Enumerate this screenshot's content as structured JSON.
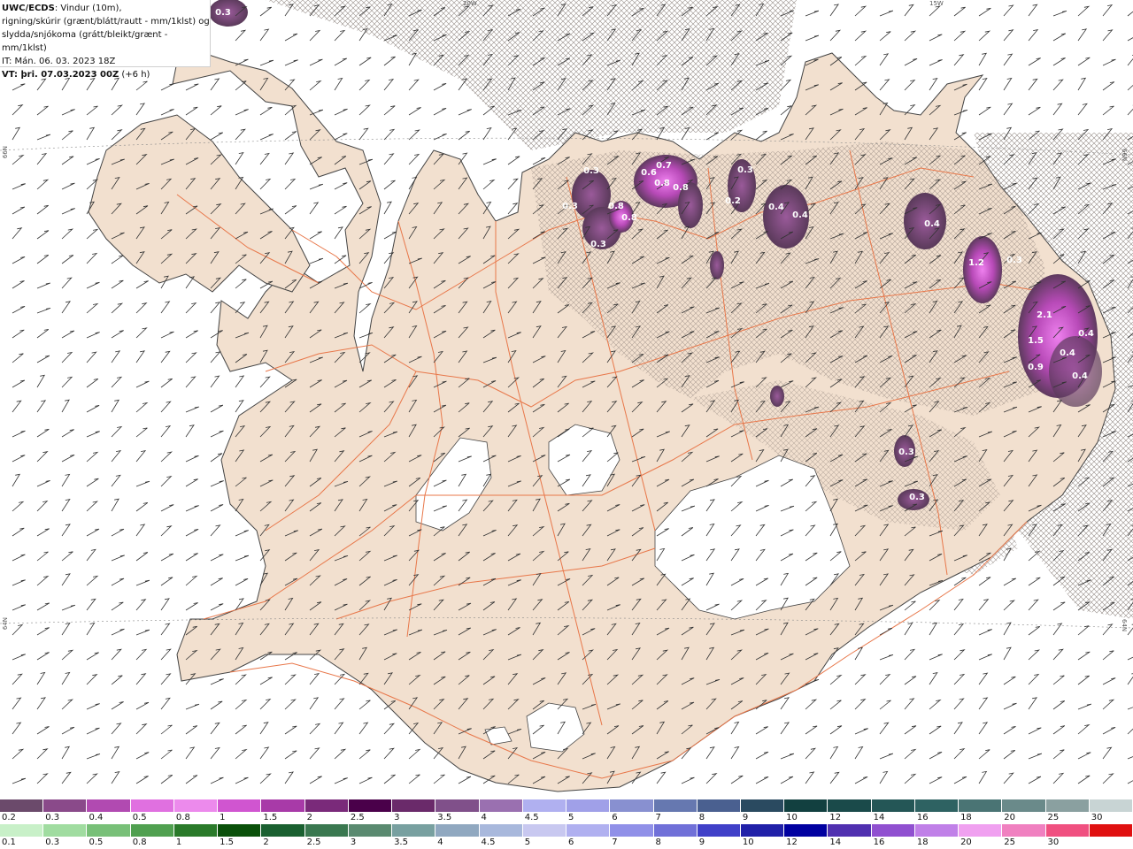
{
  "info": {
    "line1_bold": "UWC/ECDS",
    "line1_rest": ": Vindur (10m),",
    "line2": "rigning/skúrir (grænt/blátt/rautt - mm/1klst) og",
    "line3": "slydda/snjókoma (grátt/bleikt/grænt - mm/1klst)",
    "line4": "IT: Mán. 06. 03. 2023 18Z",
    "line5_bold": "VT: þri. 07.03.2023 00Z",
    "line5_rest": " (+6 h)"
  },
  "coords": {
    "top_left": "20W",
    "top_right": "15W",
    "right_upper": "66N",
    "right_lower": "64N",
    "left_upper": "66N",
    "left_lower": "64N"
  },
  "map_labels": [
    {
      "text": "0.3"
    },
    {
      "text": "0.3"
    },
    {
      "text": "0.3"
    },
    {
      "text": "0.3"
    },
    {
      "text": "0.6"
    },
    {
      "text": "0.7"
    },
    {
      "text": "0.8"
    },
    {
      "text": "0.8"
    },
    {
      "text": "0.8"
    },
    {
      "text": "0.8"
    },
    {
      "text": "0.3"
    },
    {
      "text": "0.2"
    },
    {
      "text": "0.4"
    },
    {
      "text": "0.4"
    },
    {
      "text": "0.4"
    },
    {
      "text": "1.2"
    },
    {
      "text": "0.3"
    },
    {
      "text": "2.1"
    },
    {
      "text": "1.5"
    },
    {
      "text": "0.9"
    },
    {
      "text": "0.4"
    },
    {
      "text": "0.4"
    },
    {
      "text": "0.4"
    },
    {
      "text": "0.3"
    },
    {
      "text": "0.3"
    }
  ],
  "legend_snow": {
    "labels": [
      "0.2",
      "0.3",
      "0.4",
      "0.5",
      "0.8",
      "1",
      "1.5",
      "2",
      "2.5",
      "3",
      "3.5",
      "4",
      "4.5",
      "5",
      "6",
      "7",
      "8",
      "9",
      "10",
      "12",
      "14",
      "16",
      "18",
      "20",
      "25",
      "30"
    ],
    "colors": [
      "#6b4a6b",
      "#8a4a8a",
      "#b14ab1",
      "#e070e0",
      "#ec8aec",
      "#d055d0",
      "#a83aa8",
      "#7a2a7a",
      "#4a004a",
      "#6a2a6a",
      "#80508a",
      "#9a70b0",
      "#b0b0f0",
      "#a0a0e8",
      "#8890d0",
      "#6678b0",
      "#4a6090",
      "#2a4a60",
      "#124040",
      "#1a4a4a",
      "#245656",
      "#2e6262",
      "#4a7474",
      "#6a8a8a",
      "#8aa0a0",
      "#c8d4d4"
    ]
  },
  "legend_rain": {
    "labels": [
      "0.1",
      "0.3",
      "0.5",
      "0.8",
      "1",
      "1.5",
      "2",
      "2.5",
      "3",
      "3.5",
      "4",
      "4.5",
      "5",
      "6",
      "7",
      "8",
      "9",
      "10",
      "12",
      "14",
      "16",
      "18",
      "20",
      "25",
      "30"
    ],
    "colors": [
      "#c8f0c8",
      "#a0dca0",
      "#78c078",
      "#50a050",
      "#2a7a2a",
      "#0a500a",
      "#1a6030",
      "#3a7850",
      "#5a8a70",
      "#78a0a0",
      "#90a8c0",
      "#a8b8dc",
      "#c8c8f0",
      "#b0b0f0",
      "#9090e8",
      "#7070d8",
      "#4040c8",
      "#2020a8",
      "#0000a0",
      "#5030b0",
      "#9050d0",
      "#c080e8",
      "#f0a0f0",
      "#f080c0",
      "#f05080",
      "#e01010"
    ]
  }
}
